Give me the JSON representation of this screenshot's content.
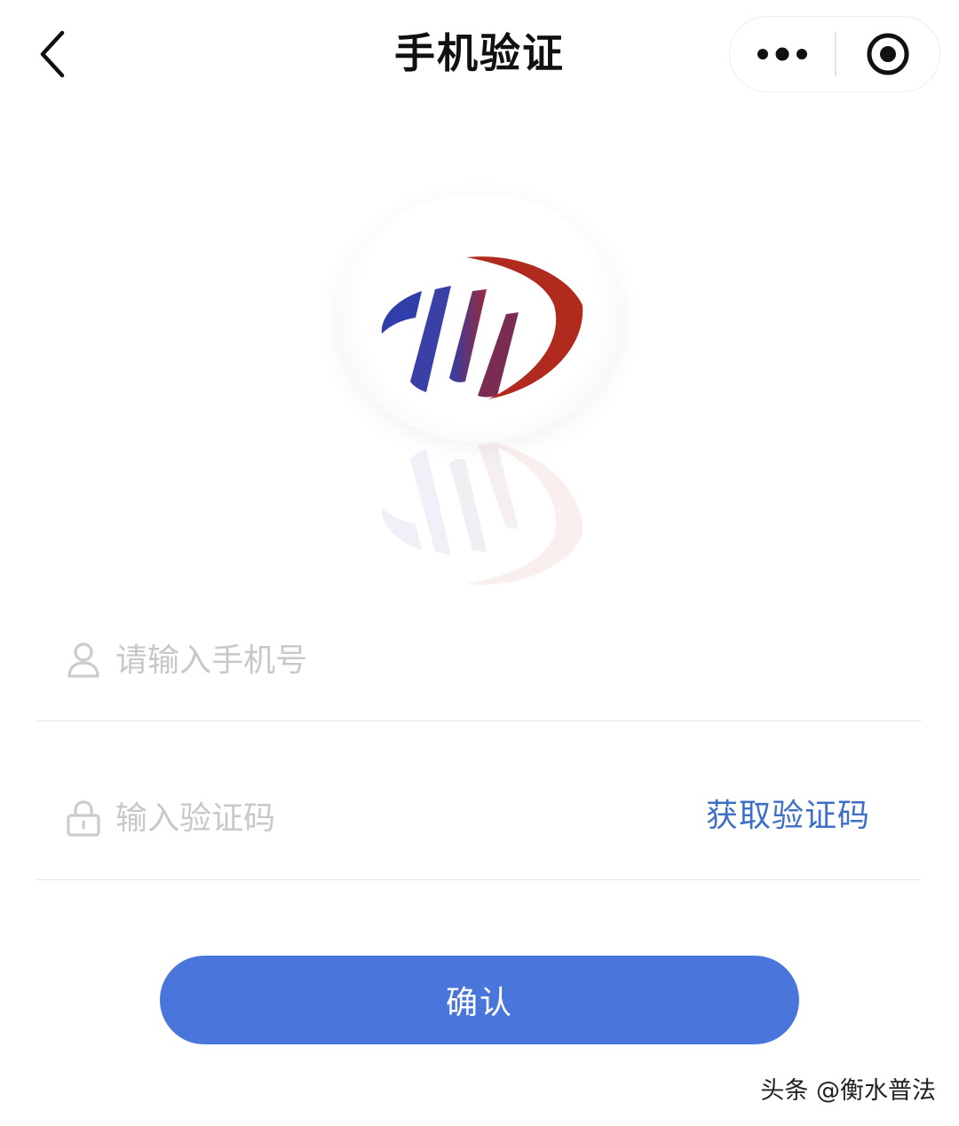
{
  "nav": {
    "title": "手机验证",
    "back_icon": "chevron-left-icon",
    "more_icon": "more-dots-icon",
    "close_icon": "target-close-icon"
  },
  "logo": {
    "colors": {
      "blue": "#2f3ea8",
      "red": "#b02a1e"
    }
  },
  "form": {
    "phone": {
      "placeholder": "请输入手机号",
      "value": "",
      "icon": "user-icon"
    },
    "code": {
      "placeholder": "输入验证码",
      "value": "",
      "icon": "lock-icon",
      "get_code_label": "获取验证码"
    }
  },
  "confirm": {
    "label": "确认",
    "color": "#4a76dc"
  },
  "watermark": "头条 @衡水普法"
}
